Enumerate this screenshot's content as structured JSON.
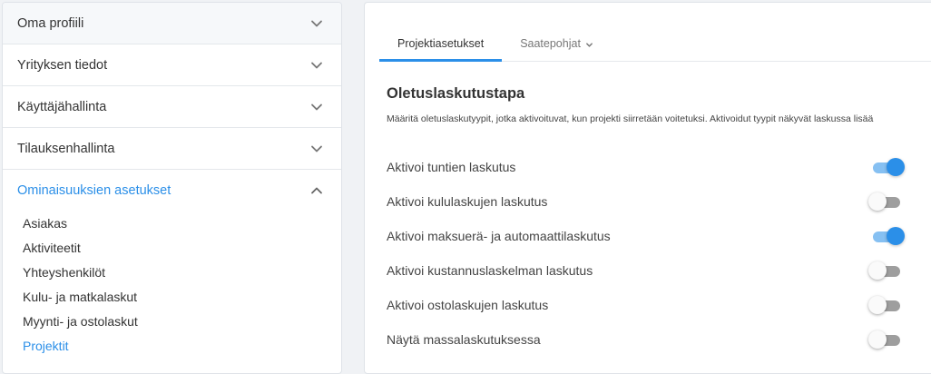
{
  "sidebar": {
    "sections": [
      {
        "label": "Oma profiili",
        "open": false
      },
      {
        "label": "Yrityksen tiedot",
        "open": false
      },
      {
        "label": "Käyttäjähallinta",
        "open": false
      },
      {
        "label": "Tilauksenhallinta",
        "open": false
      },
      {
        "label": "Ominaisuuksien asetukset",
        "open": true
      }
    ],
    "subitems": [
      {
        "label": "Asiakas",
        "active": false
      },
      {
        "label": "Aktiviteetit",
        "active": false
      },
      {
        "label": "Yhteyshenkilöt",
        "active": false
      },
      {
        "label": "Kulu- ja matkalaskut",
        "active": false
      },
      {
        "label": "Myynti- ja ostolaskut",
        "active": false
      },
      {
        "label": "Projektit",
        "active": true
      }
    ]
  },
  "main": {
    "tabs": [
      {
        "label": "Projektiasetukset",
        "active": true
      },
      {
        "label": "Saatepohjat",
        "active": false,
        "has_dropdown": true
      }
    ],
    "section_title": "Oletuslaskutustapa",
    "section_description": "Määritä oletuslaskutyypit, jotka aktivoituvat, kun projekti siirretään voitetuksi. Aktivoidut tyypit näkyvät laskussa lisää",
    "toggles": [
      {
        "label": "Aktivoi tuntien laskutus",
        "on": true
      },
      {
        "label": "Aktivoi kululaskujen laskutus",
        "on": false
      },
      {
        "label": "Aktivoi maksuerä- ja automaattilaskutus",
        "on": true
      },
      {
        "label": "Aktivoi kustannuslaskelman laskutus",
        "on": false
      },
      {
        "label": "Aktivoi ostolaskujen laskutus",
        "on": false
      },
      {
        "label": "Näytä massalaskutuksessa",
        "on": false
      }
    ]
  },
  "colors": {
    "accent": "#2b8fe8",
    "toggle_on_track": "#86c0f2",
    "toggle_off_track": "#9e9e9e"
  },
  "icons": {
    "accordion_closed": "chevron-down-icon",
    "accordion_open": "chevron-up-icon",
    "tab_dropdown": "chevron-down-icon"
  }
}
